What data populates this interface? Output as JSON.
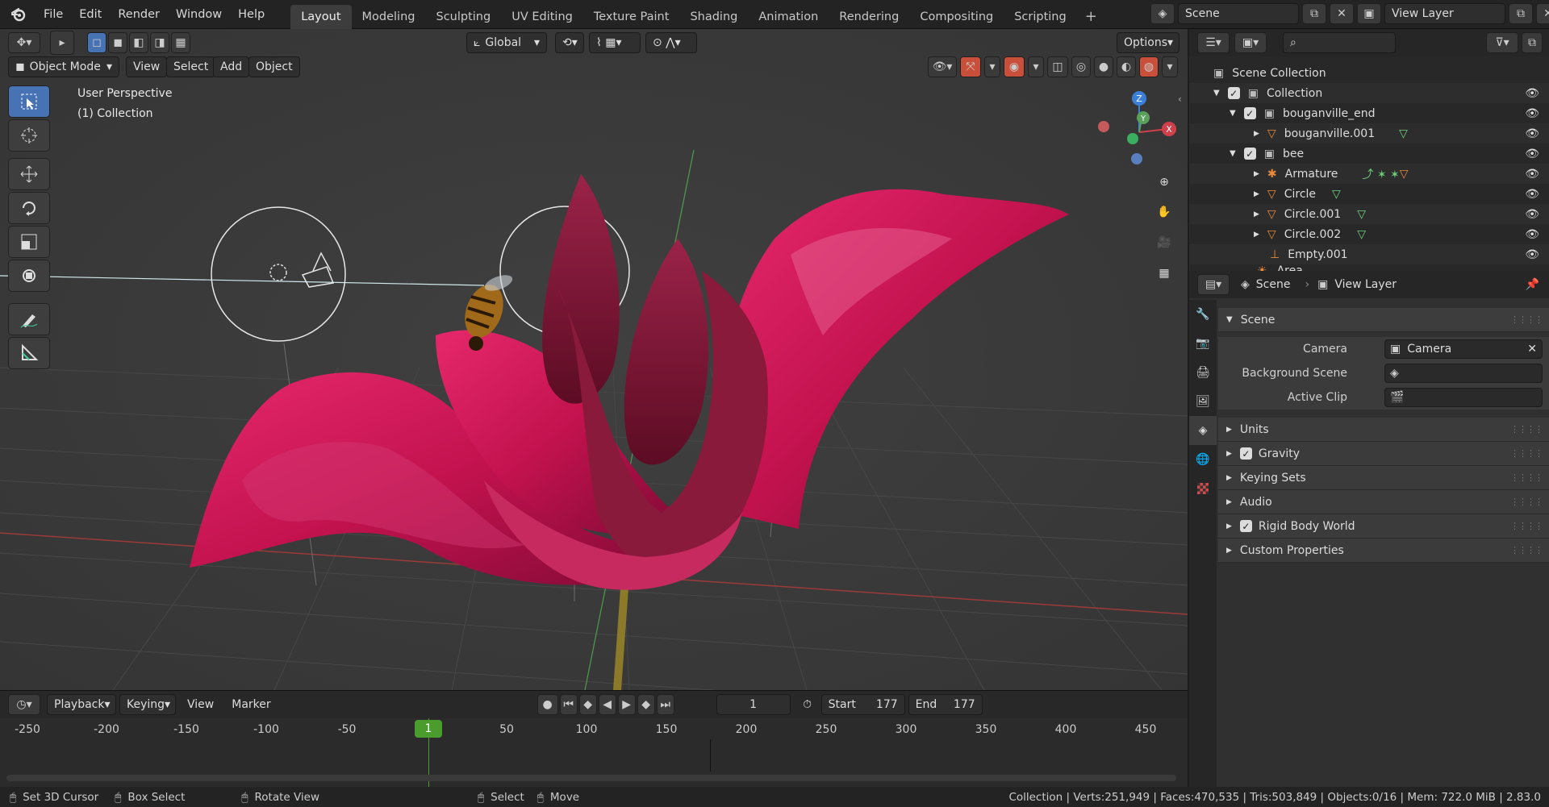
{
  "menus": [
    "File",
    "Edit",
    "Render",
    "Window",
    "Help"
  ],
  "tabs": [
    "Layout",
    "Modeling",
    "Sculpting",
    "UV Editing",
    "Texture Paint",
    "Shading",
    "Animation",
    "Rendering",
    "Compositing",
    "Scripting"
  ],
  "active_tab": "Layout",
  "scene_name": "Scene",
  "view_layer_name": "View Layer",
  "toolbar": {
    "orientation": "Global",
    "options": "Options"
  },
  "viewport": {
    "mode": "Object Mode",
    "menu": [
      "View",
      "Select",
      "Add",
      "Object"
    ],
    "overlay_text_1": "User Perspective",
    "overlay_text_2": "(1) Collection",
    "gizmo": {
      "z": "Z",
      "y": "Y",
      "x": "X"
    }
  },
  "timeline": {
    "menus": [
      "Playback",
      "Keying",
      "View",
      "Marker"
    ],
    "current_frame": "1",
    "start_label": "Start",
    "start": "177",
    "end_label": "End",
    "end": "177",
    "ticks": [
      "-250",
      "-200",
      "-150",
      "-100",
      "-50",
      "1",
      "50",
      "100",
      "150",
      "200",
      "250",
      "300",
      "350",
      "400",
      "450"
    ]
  },
  "outliner": {
    "root": "Scene Collection",
    "items": [
      {
        "label": "Collection"
      },
      {
        "label": "bouganville_end"
      },
      {
        "label": "bouganville.001"
      },
      {
        "label": "bee"
      },
      {
        "label": "Armature"
      },
      {
        "label": "Circle"
      },
      {
        "label": "Circle.001"
      },
      {
        "label": "Circle.002"
      },
      {
        "label": "Empty.001"
      },
      {
        "label": "Area"
      }
    ]
  },
  "properties": {
    "breadcrumb_scene": "Scene",
    "breadcrumb_layer": "View Layer",
    "section": "Scene",
    "camera_label": "Camera",
    "camera_value": "Camera",
    "bg_scene_label": "Background Scene",
    "active_clip_label": "Active Clip",
    "subsections": [
      "Units",
      "Gravity",
      "Keying Sets",
      "Audio",
      "Rigid Body World",
      "Custom Properties"
    ]
  },
  "status": {
    "hint1": "Set 3D Cursor",
    "hint2": "Box Select",
    "hint3": "Rotate View",
    "hint4": "Select",
    "hint5": "Move",
    "stats": "Collection | Verts:251,949 | Faces:470,535 | Tris:503,849 | Objects:0/16 | Mem: 722.0 MiB | 2.83.0"
  },
  "colors": {
    "accent": "#4772b3",
    "petal": "#c2124e",
    "frame_marker": "#4a9c2d"
  }
}
